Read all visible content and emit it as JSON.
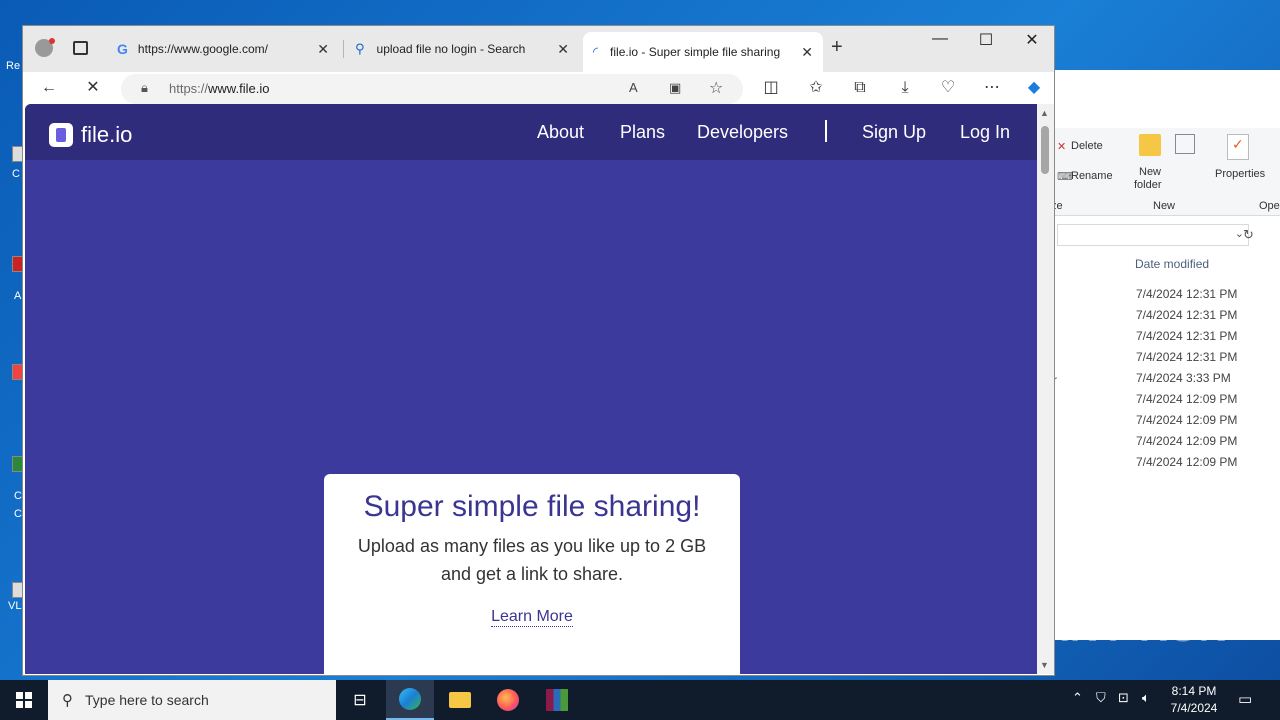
{
  "browser": {
    "tabs": [
      {
        "label": "https://www.google.com/",
        "icon": "google-icon"
      },
      {
        "label": "upload file no login - Search",
        "icon": "search-icon"
      },
      {
        "label": "file.io - Super simple file sharing",
        "icon": "loading-icon"
      }
    ],
    "new_tab": "+",
    "url_prefix": "https://",
    "url_host": "www.file.io"
  },
  "site": {
    "logo": "file.io",
    "nav": [
      "About",
      "Plans",
      "Developers",
      "Sign Up",
      "Log In"
    ],
    "hero_title": "Super simple file sharing!",
    "hero_text": "Upload as many files as you like up to 2 GB and get a link to share.",
    "learn_more": "Learn More"
  },
  "explorer": {
    "delete": "Delete",
    "rename": "Rename",
    "new_folder_line1": "New",
    "new_folder_line2": "folder",
    "properties": "Properties",
    "group_new": "New",
    "group_ze": "ze",
    "group_ope": "Ope",
    "col_date": "Date modified",
    "row_r": "r",
    "dates": [
      "7/4/2024 12:31 PM",
      "7/4/2024 12:31 PM",
      "7/4/2024 12:31 PM",
      "7/4/2024 12:31 PM",
      "7/4/2024 3:33 PM",
      "7/4/2024 12:09 PM",
      "7/4/2024 12:09 PM",
      "7/4/2024 12:09 PM",
      "7/4/2024 12:09 PM"
    ]
  },
  "desktop": {
    "labels": [
      "Re",
      "C",
      "A",
      "C",
      "C",
      "VL"
    ]
  },
  "taskbar": {
    "search_placeholder": "Type here to search",
    "time": "8:14 PM",
    "date": "7/4/2024"
  },
  "watermark": "ANY RUN",
  "colors": {
    "brand": "#3d3a9d",
    "nav": "#2f2c7c",
    "title": "#3b3592"
  }
}
